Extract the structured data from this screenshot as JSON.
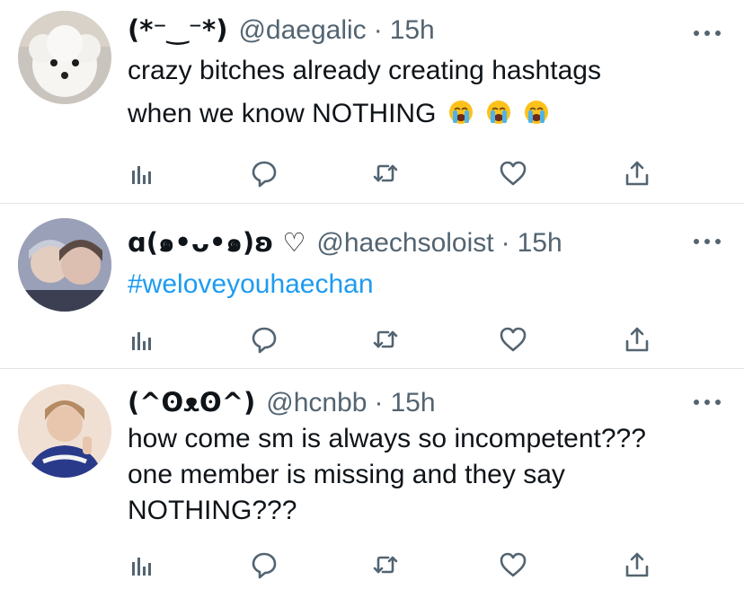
{
  "colors": {
    "text": "#0f1419",
    "muted": "#536471",
    "link": "#1d9bf0",
    "divider": "#e1e4e7"
  },
  "tweets": [
    {
      "name": "(*⁻‿⁻*)",
      "handle": "@daegalic",
      "separator": "·",
      "time": "15h",
      "text_lines": [
        "crazy bitches already creating hashtags",
        "when we know NOTHING"
      ],
      "emoji": [
        "loudly-crying-face",
        "loudly-crying-face",
        "loudly-crying-face"
      ],
      "avatar": "white-poodle-avatar"
    },
    {
      "name": "ɑ(๑•ᴗ•๑)ʚ ♡",
      "handle": "@haechsoloist",
      "separator": "·",
      "time": "15h",
      "hashtag": "#weloveyouhaechan",
      "avatar": "two-people-selfie-avatar"
    },
    {
      "name": "(^ʘᴥʘ^)",
      "handle": "@hcnbb",
      "separator": "·",
      "time": "15h",
      "text_lines": [
        "how come sm is always so incompetent???",
        "one member is missing and they say",
        "NOTHING???"
      ],
      "avatar": "person-peace-sign-avatar"
    }
  ],
  "actions": [
    "analytics-icon",
    "reply-icon",
    "retweet-icon",
    "like-icon",
    "share-icon"
  ]
}
